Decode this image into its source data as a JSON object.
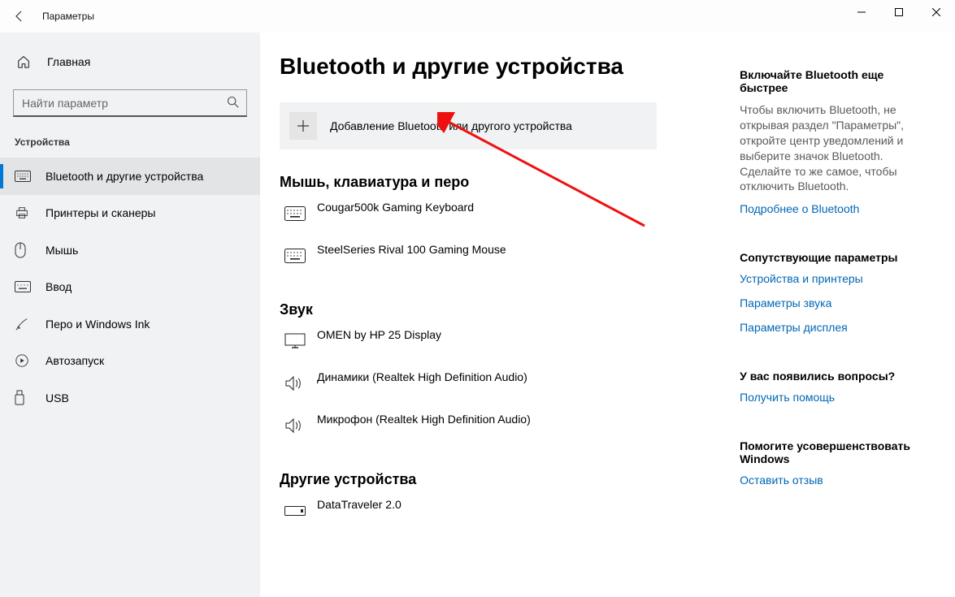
{
  "titlebar": {
    "title": "Параметры"
  },
  "sidebar": {
    "home": "Главная",
    "search_placeholder": "Найти параметр",
    "header": "Устройства",
    "items": [
      {
        "label": "Bluetooth и другие устройства"
      },
      {
        "label": "Принтеры и сканеры"
      },
      {
        "label": "Мышь"
      },
      {
        "label": "Ввод"
      },
      {
        "label": "Перо и Windows Ink"
      },
      {
        "label": "Автозапуск"
      },
      {
        "label": "USB"
      }
    ]
  },
  "content": {
    "heading": "Bluetooth и другие устройства",
    "add_button": "Добавление Bluetooth или другого устройства",
    "section_input": "Мышь, клавиатура и перо",
    "input_devices": [
      "Cougar500k Gaming Keyboard",
      "SteelSeries Rival 100 Gaming Mouse"
    ],
    "section_sound": "Звук",
    "sound_devices": [
      "OMEN by HP 25 Display",
      "Динамики (Realtek High Definition Audio)",
      "Микрофон (Realtek High Definition Audio)"
    ],
    "section_other": "Другие устройства",
    "other_devices": [
      "DataTraveler 2.0"
    ]
  },
  "right": {
    "fast_hdr": "Включайте Bluetooth еще быстрее",
    "fast_txt": "Чтобы включить Bluetooth, не открывая раздел \"Параметры\", откройте центр уведомлений и выберите значок Bluetooth. Сделайте то же самое, чтобы отключить Bluetooth.",
    "fast_link": "Подробнее о Bluetooth",
    "related_hdr": "Сопутствующие параметры",
    "related_links": [
      "Устройства и принтеры",
      "Параметры звука",
      "Параметры дисплея"
    ],
    "questions_hdr": "У вас появились вопросы?",
    "help_link": "Получить помощь",
    "improve_hdr": "Помогите усовершенствовать Windows",
    "feedback_link": "Оставить отзыв"
  }
}
